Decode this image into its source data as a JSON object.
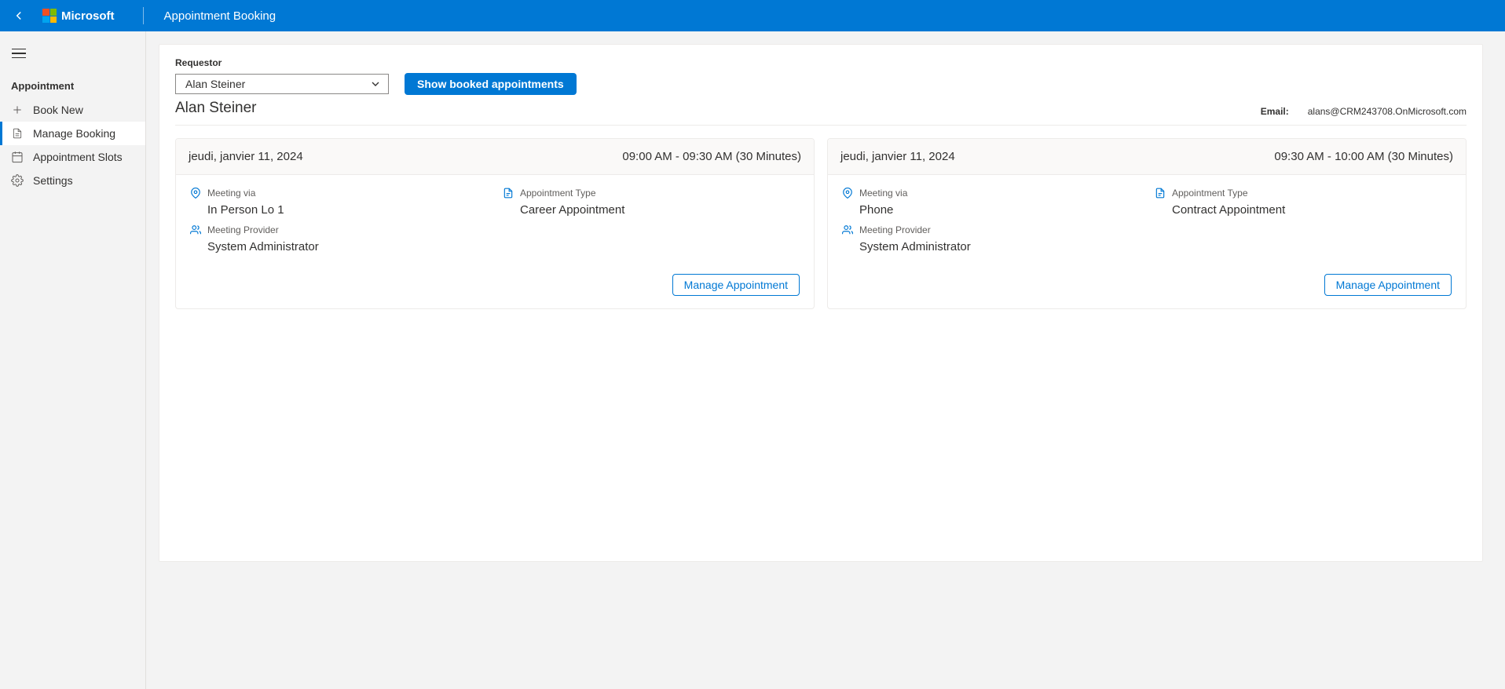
{
  "header": {
    "brand": "Microsoft",
    "title": "Appointment Booking"
  },
  "sidebar": {
    "heading": "Appointment",
    "items": [
      {
        "label": "Book New"
      },
      {
        "label": "Manage Booking"
      },
      {
        "label": "Appointment Slots"
      },
      {
        "label": "Settings"
      }
    ]
  },
  "requestor": {
    "label": "Requestor",
    "selected": "Alan Steiner",
    "show_button": "Show booked appointments",
    "name": "Alan Steiner",
    "email_label": "Email:",
    "email_value": "alans@CRM243708.OnMicrosoft.com"
  },
  "labels": {
    "meeting_via": "Meeting via",
    "appointment_type": "Appointment Type",
    "meeting_provider": "Meeting Provider",
    "manage_appointment": "Manage Appointment"
  },
  "appointments": [
    {
      "date": "jeudi, janvier 11, 2024",
      "time": "09:00 AM - 09:30 AM (30 Minutes)",
      "meeting_via": "In Person Lo 1",
      "appointment_type": "Career Appointment",
      "meeting_provider": "System Administrator"
    },
    {
      "date": "jeudi, janvier 11, 2024",
      "time": "09:30 AM - 10:00 AM (30 Minutes)",
      "meeting_via": "Phone",
      "appointment_type": "Contract Appointment",
      "meeting_provider": "System Administrator"
    }
  ]
}
